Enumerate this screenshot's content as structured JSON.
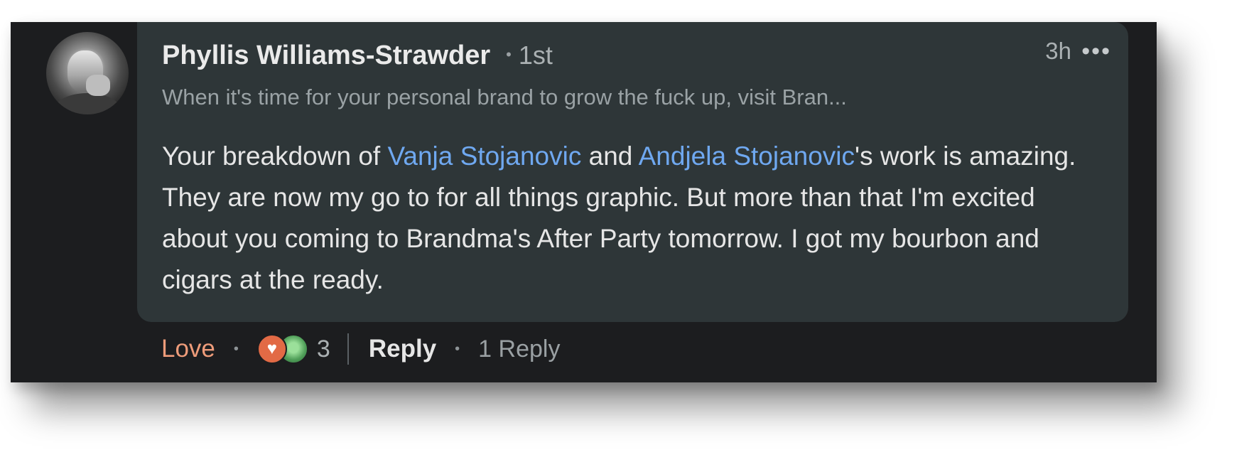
{
  "comment": {
    "author_name": "Phyllis Williams-Strawder",
    "connection_degree": "1st",
    "headline": "When it's time for your personal brand to grow the fuck up, visit Bran...",
    "timestamp": "3h",
    "more_icon": "•••",
    "text": {
      "part1": "Your breakdown of ",
      "mention1": "Vanja Stojanovic",
      "part2": " and ",
      "mention2": "Andjela Stojanovic",
      "part3": "'s work is amazing. They are now my go to for all things graphic. But more than that I'm excited about you coming to Brandma's After Party tomorrow. I got my bourbon and cigars at the ready."
    }
  },
  "actions": {
    "reaction_label": "Love",
    "reaction_count": "3",
    "reply_label": "Reply",
    "reply_count_label": "1 Reply"
  },
  "colors": {
    "card_bg": "#1c1d1f",
    "bubble_bg": "#2e3638",
    "mention": "#6fa8f0",
    "love": "#ee9c7a"
  },
  "icons": {
    "separator": "•",
    "heart": "♥"
  }
}
